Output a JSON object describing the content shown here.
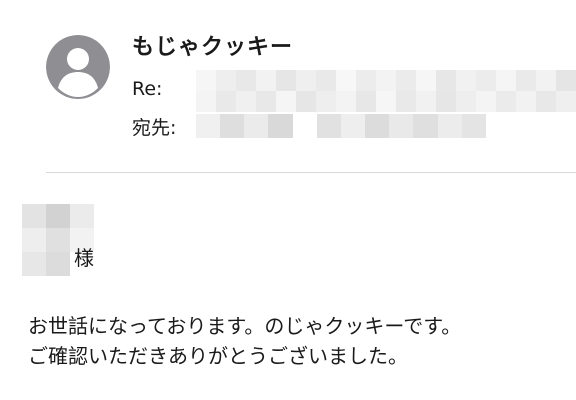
{
  "email": {
    "sender_name": "もじゃクッキー",
    "subject_label": "Re:",
    "recipient_label": "宛先:",
    "honorific": "様",
    "body_lines": [
      "お世話になっております。のじゃクッキーです。",
      "ご確認いただきありがとうございました。"
    ]
  },
  "icons": {
    "avatar": "person-silhouette-icon"
  },
  "colors": {
    "avatar_bg": "#8e8e93",
    "avatar_fg": "#ffffff",
    "divider": "#d9d9d9",
    "text": "#1a1a1a"
  }
}
